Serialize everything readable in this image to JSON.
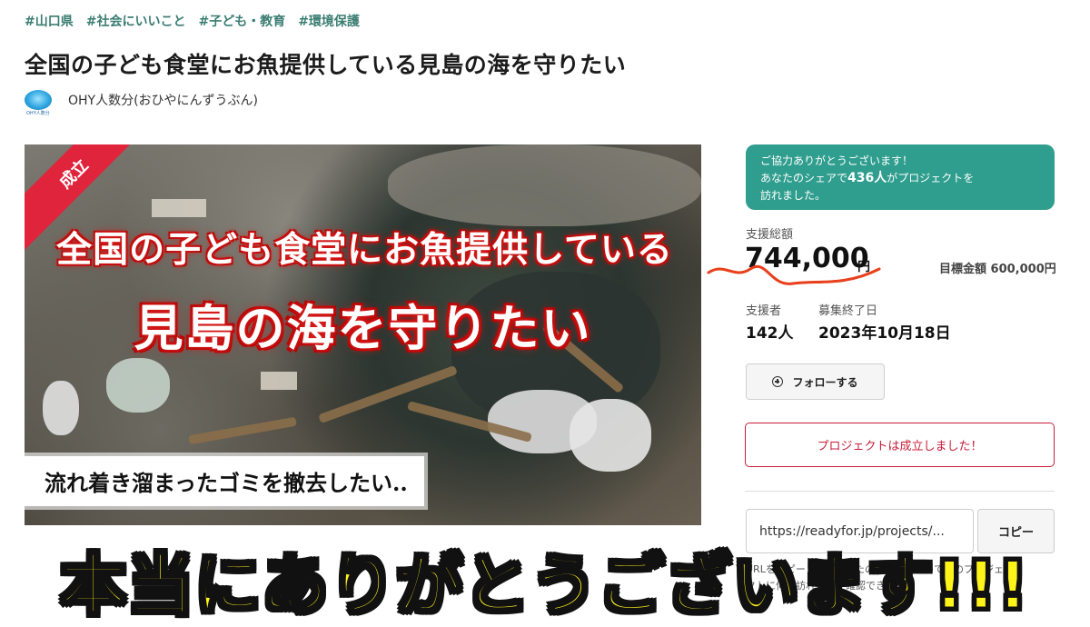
{
  "tags": [
    "#山口県",
    "#社会にいいこと",
    "#子ども・教育",
    "#環境保護"
  ],
  "title": "全国の子ども食堂にお魚提供している見島の海を守りたい",
  "owner": {
    "name": "OHY人数分(おひやにんずうぶん)"
  },
  "hero": {
    "ribbon": "成立",
    "caption_line1": "全国の子ども食堂にお魚提供している",
    "caption_line2": "見島の海を守りたい",
    "caption_line3": "流れ着き溜まったゴミを撤去したい.."
  },
  "share_toast": {
    "line1": "ご協力ありがとうございます！",
    "prefix": "あなたのシェアで",
    "count": "436人",
    "suffix": "がプロジェクトを",
    "line3": "訪れました。"
  },
  "funding": {
    "total_label": "支援総額",
    "total_amount": "744,000",
    "currency": "円",
    "target_label": "目標金額",
    "target_amount": "600,000円",
    "supporters_label": "支援者",
    "supporters_value": "142人",
    "end_label": "募集終了日",
    "end_value": "2023年10月18日"
  },
  "actions": {
    "follow_label": "フォローする",
    "success_label": "プロジェクトは成立しました！",
    "share_url": "https://readyfor.jp/projects/...",
    "copy_label": "コピー",
    "note_line1": "URLをコピーして、あなたのシェアによってこのプロジェ",
    "note_line2": "クトに何人訪れたかが確認できます"
  },
  "overlay_banner": "本当にありがとうございます!!!",
  "colors": {
    "accent_teal": "#2f9e8e",
    "tag_green": "#3a7d72",
    "success_red": "#c81e3a",
    "banner_yellow": "#fff31a"
  }
}
